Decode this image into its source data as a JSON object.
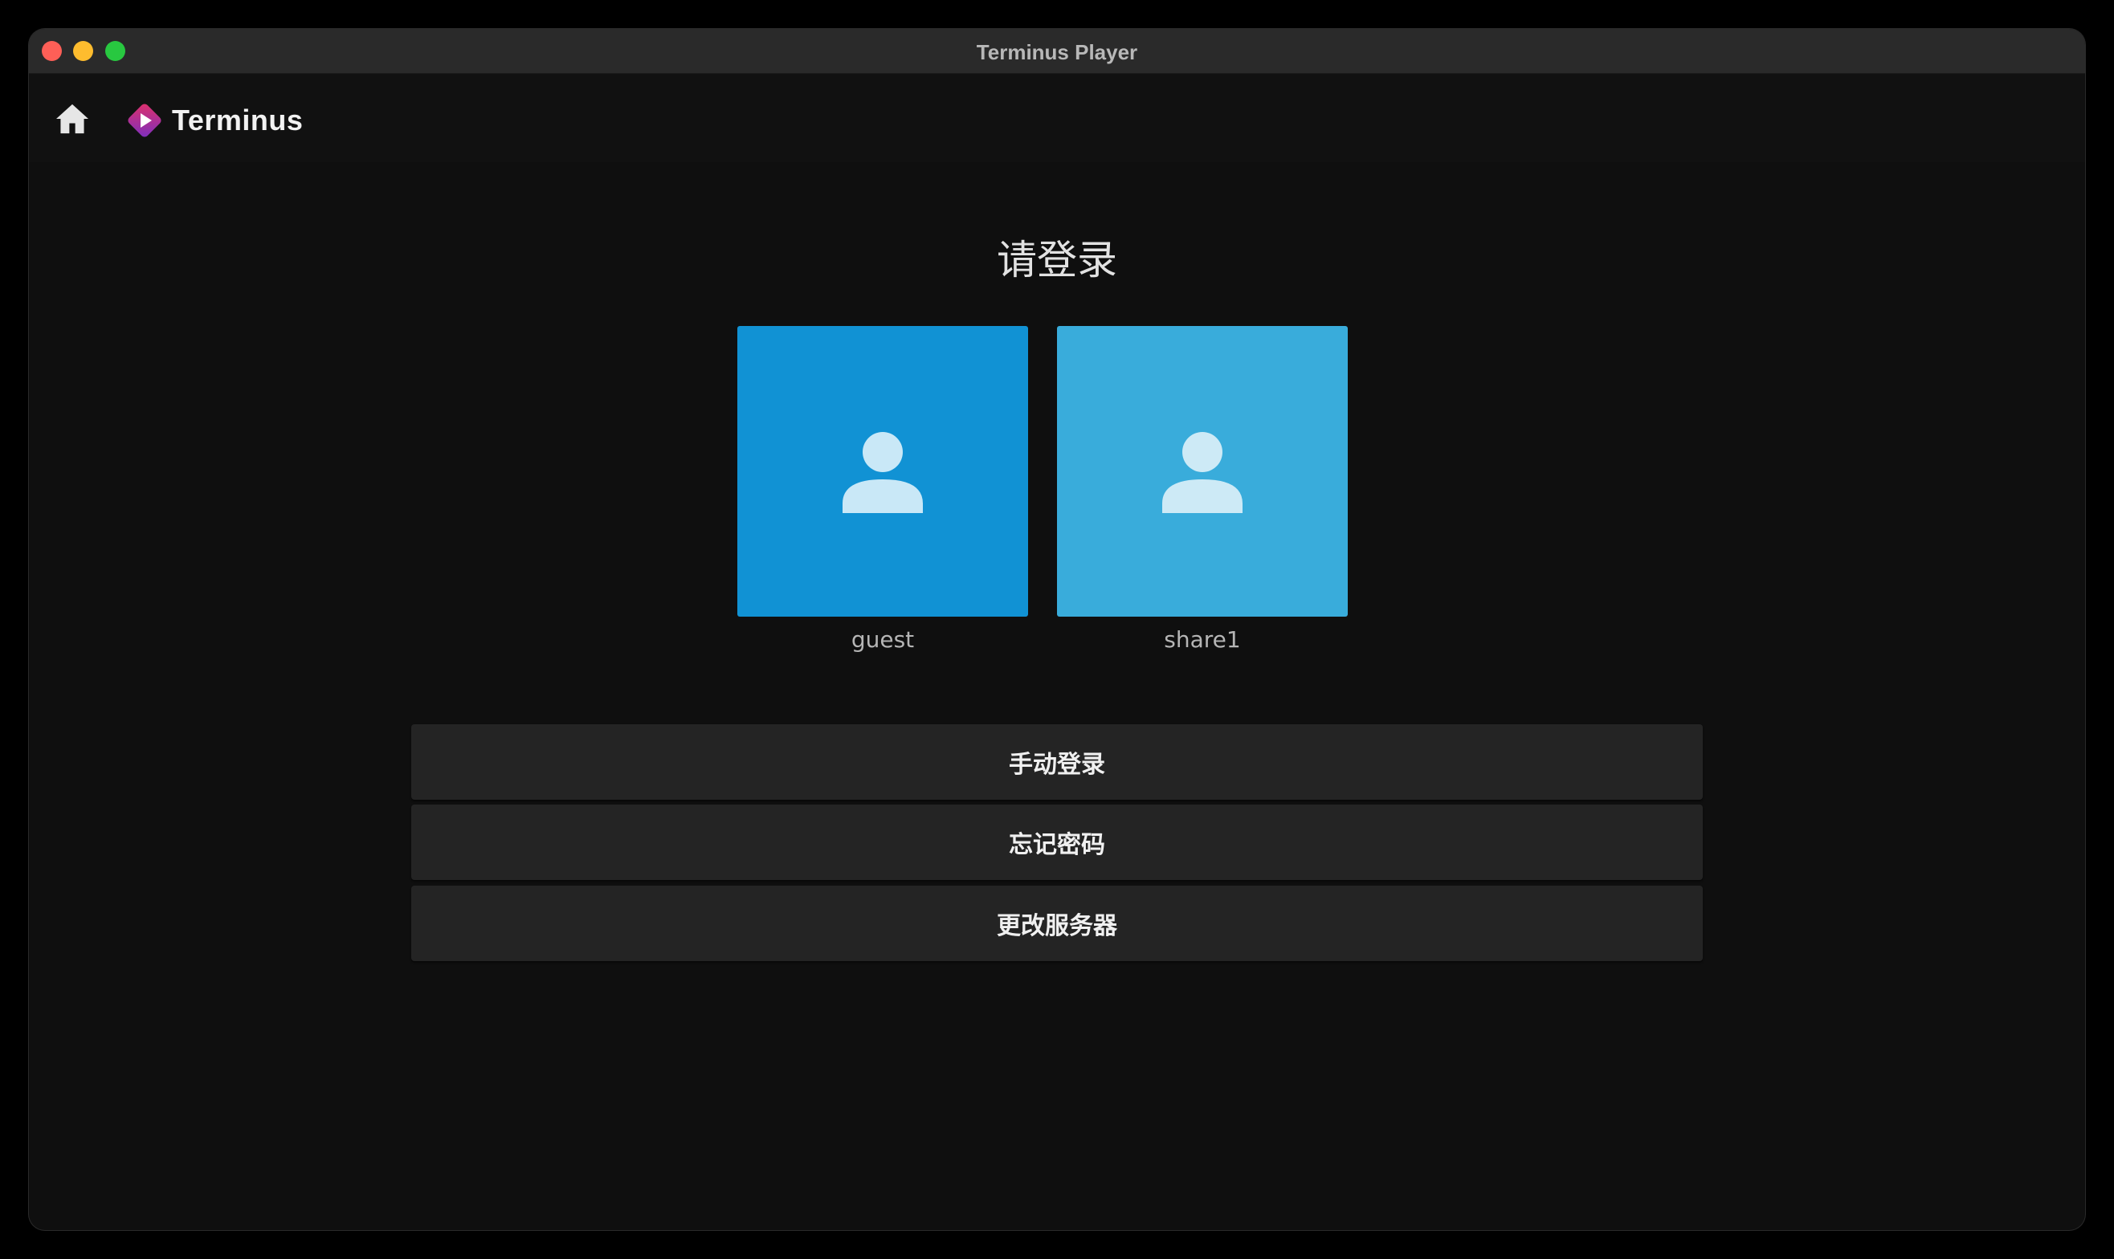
{
  "window": {
    "title": "Terminus Player"
  },
  "appbar": {
    "home_icon": "home-icon",
    "logo_text": "Terminus",
    "logo_colors": [
      "#e0306a",
      "#7b2fbf"
    ]
  },
  "login": {
    "heading": "请登录",
    "users": [
      {
        "name": "guest",
        "tile_color": "#1192d4",
        "icon": "person-icon"
      },
      {
        "name": "share1",
        "tile_color": "#39acdb",
        "icon": "person-icon"
      }
    ],
    "buttons": {
      "manual_login": "手动登录",
      "forgot_password": "忘记密码",
      "change_server": "更改服务器"
    }
  }
}
